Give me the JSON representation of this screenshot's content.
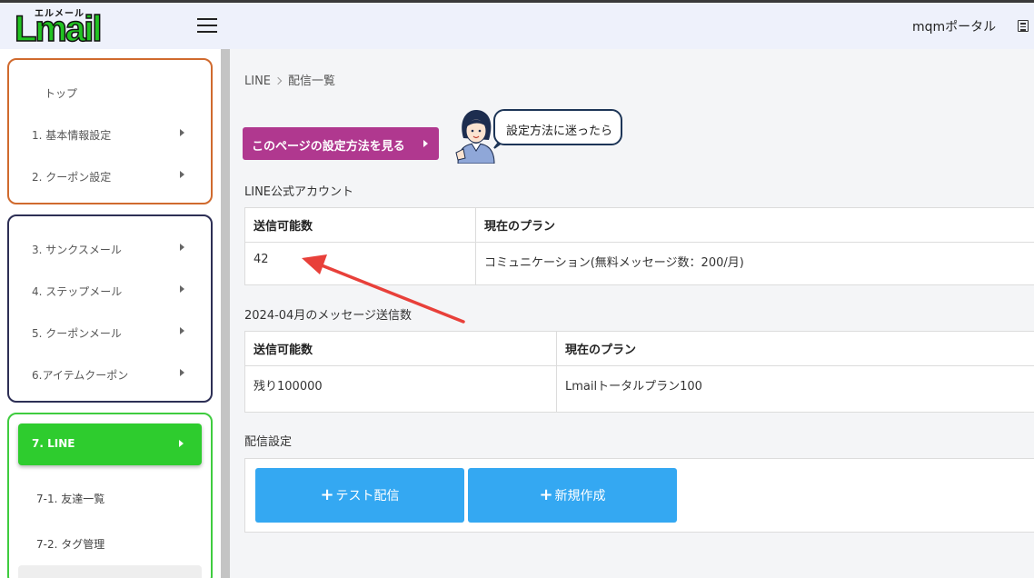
{
  "app": {
    "logo_kana": "エルメール",
    "logo_text": "Lmail"
  },
  "header": {
    "portal_label": "mqmポータル"
  },
  "sidebar": {
    "group1": [
      {
        "label": "トップ",
        "has_arrow": false
      },
      {
        "label": "1. 基本情報設定",
        "has_arrow": true
      },
      {
        "label": "2. クーポン設定",
        "has_arrow": true
      }
    ],
    "group2": [
      {
        "label": "3. サンクスメール",
        "has_arrow": true
      },
      {
        "label": "4. ステップメール",
        "has_arrow": true
      },
      {
        "label": "5. クーポンメール",
        "has_arrow": true
      },
      {
        "label": "6.アイテムクーポン",
        "has_arrow": true
      }
    ],
    "active": {
      "label": "7. LINE"
    },
    "sub_items": [
      {
        "label": "7-1. 友達一覧"
      },
      {
        "label": "7-2. タグ管理"
      }
    ]
  },
  "breadcrumb": {
    "root": "LINE",
    "current": "配信一覧"
  },
  "howto": {
    "button_label": "このページの設定方法を見る",
    "bubble_text": "設定方法に迷ったら"
  },
  "account_section": {
    "title": "LINE公式アカウント",
    "headers": [
      "送信可能数",
      "現在のプラン"
    ],
    "row": [
      "42",
      "コミュニケーション(無料メッセージ数：200/月)"
    ]
  },
  "monthly_section": {
    "title": "2024-04月のメッセージ送信数",
    "headers": [
      "送信可能数",
      "現在のプラン"
    ],
    "row": [
      "残り100000",
      "Lmailトータルプラン100"
    ]
  },
  "delivery_section": {
    "title": "配信設定",
    "test_button": "テスト配信",
    "new_button": "新規作成"
  },
  "colors": {
    "brand_green": "#2ecc2e",
    "howto_magenta": "#b0388f",
    "action_blue": "#34a8f2",
    "annotation_red": "#e8403a"
  }
}
